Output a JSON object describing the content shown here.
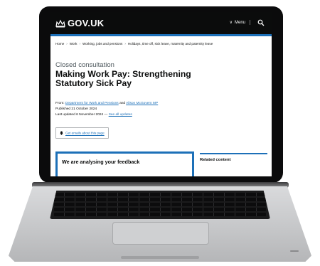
{
  "header": {
    "logo_text": "GOV.UK",
    "menu_label": "Menu",
    "icons": [
      "crown-icon",
      "chevron-down-icon",
      "search-icon"
    ]
  },
  "breadcrumb": [
    "Home",
    "Work",
    "Working, jobs and pensions",
    "Holidays, time off, sick leave, maternity and paternity leave"
  ],
  "page": {
    "caption": "Closed consultation",
    "title": "Making Work Pay: Strengthening Statutory Sick Pay",
    "from_label": "From:",
    "from_org": "Department for Work and Pensions",
    "from_and": "and",
    "from_person": "Alison McGovern MP",
    "published": "Published 21 October 2024",
    "updated": "Last updated 6 November 2024 —",
    "see_updates": "See all updates",
    "email_signup": "Get emails about this page",
    "notice": "We are analysing your feedback",
    "related_title": "Related content"
  },
  "colors": {
    "header_bg": "#0b0c0c",
    "accent_blue": "#1d70b8",
    "text": "#0b0c0c"
  }
}
